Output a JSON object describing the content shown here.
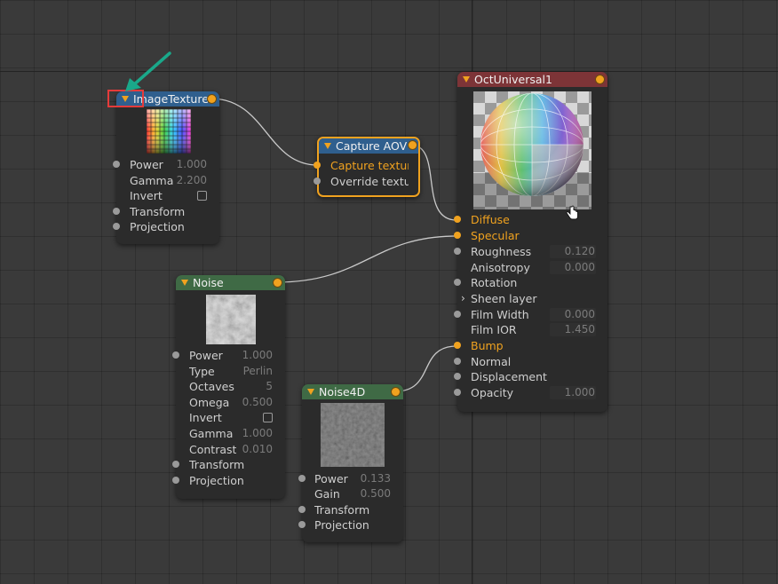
{
  "colors": {
    "accent": "#f0a21f",
    "header_blue": "#2f5f8e",
    "header_green": "#3f6a45",
    "header_red": "#7d3437",
    "highlight_box": "#e53b3b",
    "arrow": "#1aa88a"
  },
  "image_texture": {
    "title": "ImageTexture",
    "rows": [
      {
        "label": "Power",
        "value": "1.000"
      },
      {
        "label": "Gamma",
        "value": "2.200"
      },
      {
        "label": "Invert",
        "value": ""
      },
      {
        "label": "Transform",
        "value": ""
      },
      {
        "label": "Projection",
        "value": ""
      }
    ]
  },
  "capture_aov": {
    "title": "Capture AOV",
    "rows": [
      {
        "label": "Capture texture"
      },
      {
        "label": "Override texture"
      }
    ]
  },
  "noise": {
    "title": "Noise",
    "rows": [
      {
        "label": "Power",
        "value": "1.000"
      },
      {
        "label": "Type",
        "value": "Perlin"
      },
      {
        "label": "Octaves",
        "value": "5"
      },
      {
        "label": "Omega",
        "value": "0.500"
      },
      {
        "label": "Invert",
        "value": ""
      },
      {
        "label": "Gamma",
        "value": "1.000"
      },
      {
        "label": "Contrast",
        "value": "0.010"
      },
      {
        "label": "Transform",
        "value": ""
      },
      {
        "label": "Projection",
        "value": ""
      }
    ]
  },
  "noise4d": {
    "title": "Noise4D",
    "rows": [
      {
        "label": "Power",
        "value": "0.133"
      },
      {
        "label": "Gain",
        "value": "0.500"
      },
      {
        "label": "Transform",
        "value": ""
      },
      {
        "label": "Projection",
        "value": ""
      }
    ]
  },
  "oct_universal": {
    "title": "OctUniversal1",
    "rows": [
      {
        "label": "Diffuse",
        "value": ""
      },
      {
        "label": "Specular",
        "value": ""
      },
      {
        "label": "Roughness",
        "value": "0.120"
      },
      {
        "label": "Anisotropy",
        "value": "0.000"
      },
      {
        "label": "Rotation",
        "value": ""
      },
      {
        "label": "Sheen layer",
        "value": ""
      },
      {
        "label": "Film Width",
        "value": "0.000"
      },
      {
        "label": "Film IOR",
        "value": "1.450"
      },
      {
        "label": "Bump",
        "value": ""
      },
      {
        "label": "Normal",
        "value": ""
      },
      {
        "label": "Displacement",
        "value": ""
      },
      {
        "label": "Opacity",
        "value": "1.000"
      }
    ]
  },
  "icons": {
    "collapse": "triangle-down-icon",
    "cursor": "hand-cursor-icon",
    "expand": "chevron-right-icon"
  }
}
